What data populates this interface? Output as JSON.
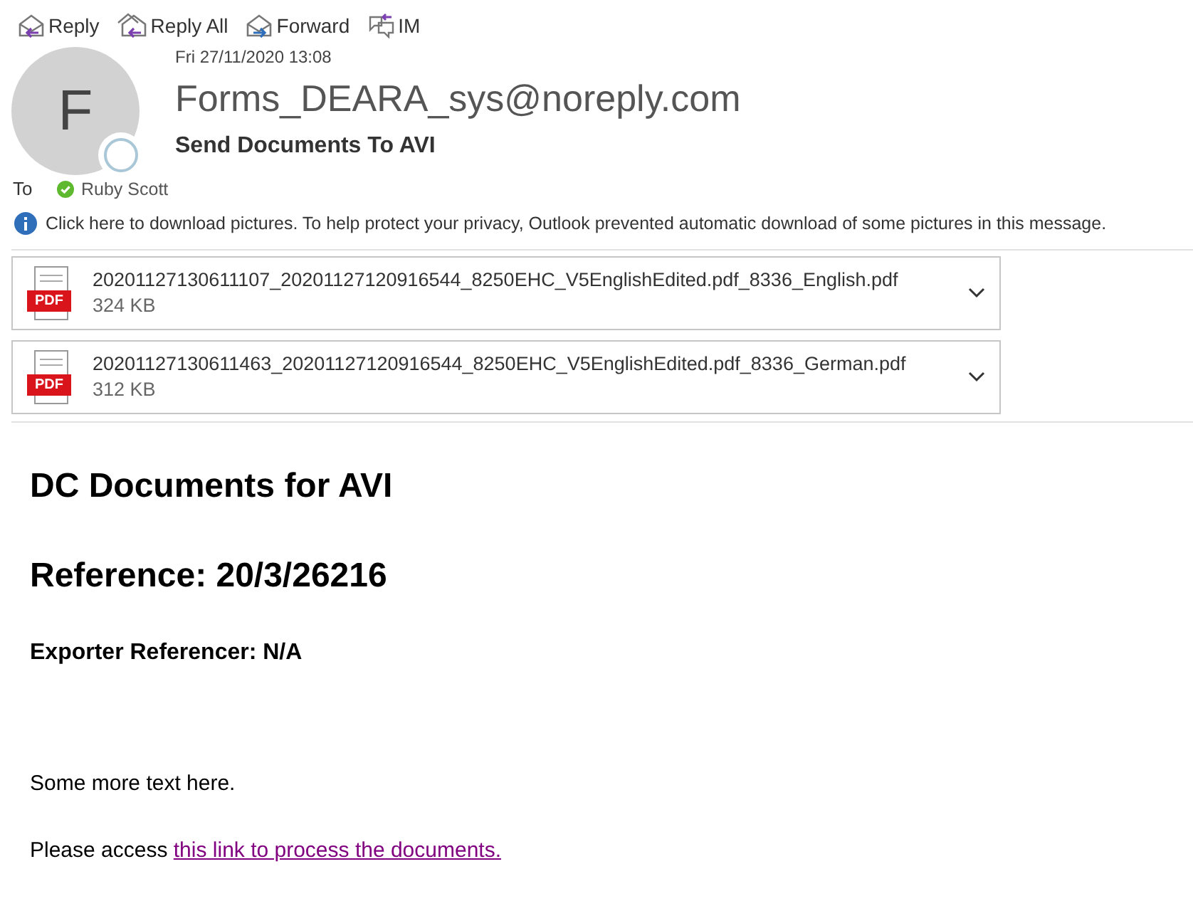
{
  "toolbar": [
    {
      "kind": "reply",
      "label": "Reply"
    },
    {
      "kind": "reply_all",
      "label": "Reply All"
    },
    {
      "kind": "forward",
      "label": "Forward"
    },
    {
      "kind": "im",
      "label": "IM"
    }
  ],
  "message": {
    "avatar_letter": "F",
    "date": "Fri 27/11/2020 13:08",
    "sender": "Forms_DEARA_sys@noreply.com",
    "subject": "Send Documents To AVI",
    "to_label": "To",
    "recipients": [
      {
        "name": "Ruby Scott",
        "available": true
      }
    ]
  },
  "info_bar": "Click here to download pictures. To help protect your privacy, Outlook prevented automatic download of some pictures in this message.",
  "attachments": [
    {
      "icon_label": "PDF",
      "name": "20201127130611107_20201127120916544_8250EHC_V5EnglishEdited.pdf_8336_English.pdf",
      "size": "324 KB"
    },
    {
      "icon_label": "PDF",
      "name": "20201127130611463_20201127120916544_8250EHC_V5EnglishEdited.pdf_8336_German.pdf",
      "size": "312 KB"
    }
  ],
  "body": [
    {
      "kind": "h1",
      "text": "DC Documents for AVI"
    },
    {
      "kind": "h1",
      "text": "Reference: 20/3/26216"
    },
    {
      "kind": "strong",
      "text": "Exporter Referencer: N/A"
    },
    {
      "kind": "para",
      "text": "Some more text here."
    },
    {
      "kind": "para_link",
      "text": "Please access ",
      "link": "this link to process the documents."
    }
  ]
}
